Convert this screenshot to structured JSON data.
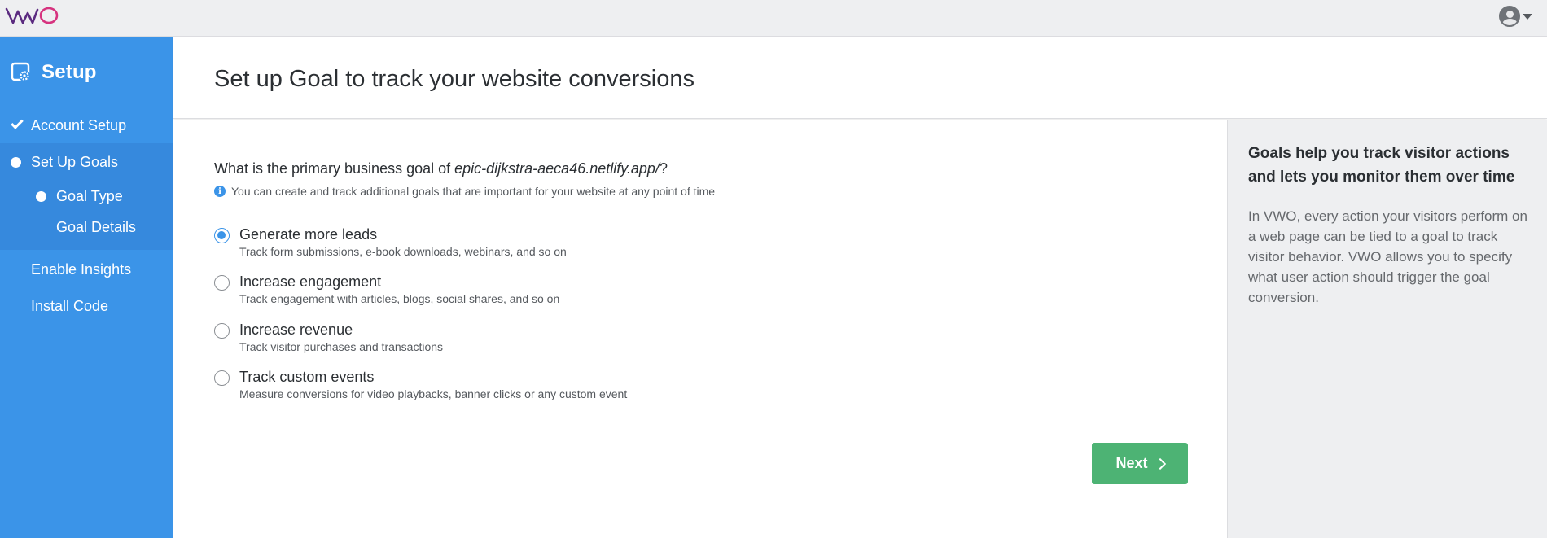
{
  "topbar": {
    "logo_text": "VWO",
    "colors": {
      "v": "#5b2b80",
      "w": "#5b2b80",
      "o": "#d6337f"
    }
  },
  "sidebar": {
    "title": "Setup",
    "title_icon": "setup-gear-icon",
    "items": [
      {
        "label": "Account Setup",
        "state": "completed",
        "icon": "check-icon"
      },
      {
        "label": "Set Up Goals",
        "state": "active",
        "icon": "dot-icon",
        "children": [
          {
            "label": "Goal Type",
            "state": "active"
          },
          {
            "label": "Goal Details",
            "state": "pending"
          }
        ]
      },
      {
        "label": "Enable Insights",
        "state": "pending"
      },
      {
        "label": "Install Code",
        "state": "pending"
      }
    ],
    "colors": {
      "background": "#3b94e8",
      "active_group": "#3689dd"
    }
  },
  "header": {
    "title": "Set up Goal to track your website conversions"
  },
  "main": {
    "question_prefix": "What is the primary business goal of ",
    "question_domain": "epic-dijkstra-aeca46.netlify.app/",
    "question_suffix": "?",
    "hint": "You can create and track additional goals that are important for your website at any point of time",
    "options": [
      {
        "title": "Generate more leads",
        "description": "Track form submissions, e-book downloads, webinars, and so on",
        "selected": true
      },
      {
        "title": "Increase engagement",
        "description": "Track engagement with articles, blogs, social shares, and so on",
        "selected": false
      },
      {
        "title": "Increase revenue",
        "description": "Track visitor purchases and transactions",
        "selected": false
      },
      {
        "title": "Track custom events",
        "description": "Measure conversions for video playbacks, banner clicks or any custom event",
        "selected": false
      }
    ],
    "next_label": "Next",
    "colors": {
      "accent": "#3b94e8",
      "next_button": "#4db374"
    }
  },
  "aside": {
    "title": "Goals help you track visitor actions and lets you monitor them over time",
    "text": "In VWO, every action your visitors perform on a web page can be tied to a goal to track visitor behavior. VWO allows you to specify what user action should trigger the goal conversion."
  }
}
